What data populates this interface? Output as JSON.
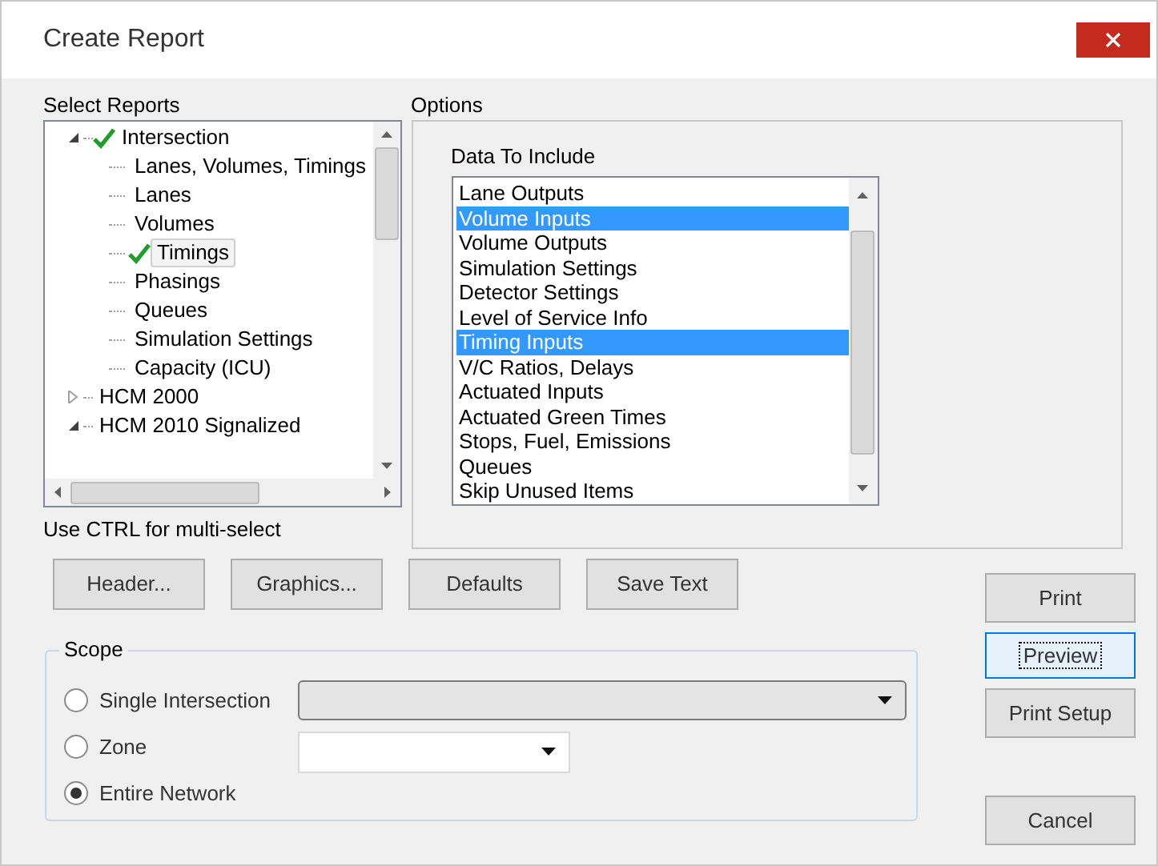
{
  "window": {
    "title": "Create Report"
  },
  "select_reports": {
    "label": "Select Reports",
    "tree": [
      {
        "label": "Intersection",
        "checked": true,
        "expanded": true,
        "selected": false,
        "children": [
          {
            "label": "Lanes, Volumes, Timings",
            "checked": false,
            "selected": false
          },
          {
            "label": "Lanes",
            "checked": false,
            "selected": false
          },
          {
            "label": "Volumes",
            "checked": false,
            "selected": false
          },
          {
            "label": "Timings",
            "checked": true,
            "selected": true
          },
          {
            "label": "Phasings",
            "checked": false,
            "selected": false
          },
          {
            "label": "Queues",
            "checked": false,
            "selected": false
          },
          {
            "label": "Simulation Settings",
            "checked": false,
            "selected": false
          },
          {
            "label": "Capacity (ICU)",
            "checked": false,
            "selected": false
          }
        ]
      },
      {
        "label": "HCM 2000",
        "checked": false,
        "expanded": false,
        "selected": false
      },
      {
        "label": "HCM 2010 Signalized",
        "checked": false,
        "expanded": true,
        "selected": false
      }
    ],
    "hint": "Use CTRL for multi-select"
  },
  "options": {
    "label": "Options",
    "list_label": "Data To Include",
    "items": [
      {
        "label": "Lane Outputs",
        "selected": false
      },
      {
        "label": "Volume Inputs",
        "selected": true
      },
      {
        "label": "Volume Outputs",
        "selected": false
      },
      {
        "label": "Simulation Settings",
        "selected": false
      },
      {
        "label": "Detector Settings",
        "selected": false
      },
      {
        "label": "Level of Service Info",
        "selected": false
      },
      {
        "label": "Timing Inputs",
        "selected": true
      },
      {
        "label": "V/C Ratios, Delays",
        "selected": false
      },
      {
        "label": "Actuated Inputs",
        "selected": false
      },
      {
        "label": "Actuated Green Times",
        "selected": false
      },
      {
        "label": "Stops, Fuel, Emissions",
        "selected": false
      },
      {
        "label": "Queues",
        "selected": false
      },
      {
        "label": "Skip Unused Items",
        "selected": false
      }
    ]
  },
  "buttons": [
    "Header...",
    "Graphics...",
    "Defaults",
    "Save Text"
  ],
  "side_buttons": [
    {
      "label": "Print",
      "focused": false
    },
    {
      "label": "Preview",
      "focused": true
    },
    {
      "label": "Print Setup",
      "focused": false
    },
    {
      "label": "Cancel",
      "focused": false
    }
  ],
  "scope": {
    "label": "Scope",
    "options": [
      {
        "label": "Single Intersection",
        "selected": false,
        "dropdown": {
          "disabled": true
        }
      },
      {
        "label": "Zone",
        "selected": false,
        "dropdown": {
          "disabled": false
        }
      },
      {
        "label": "Entire Network",
        "selected": true
      }
    ]
  }
}
